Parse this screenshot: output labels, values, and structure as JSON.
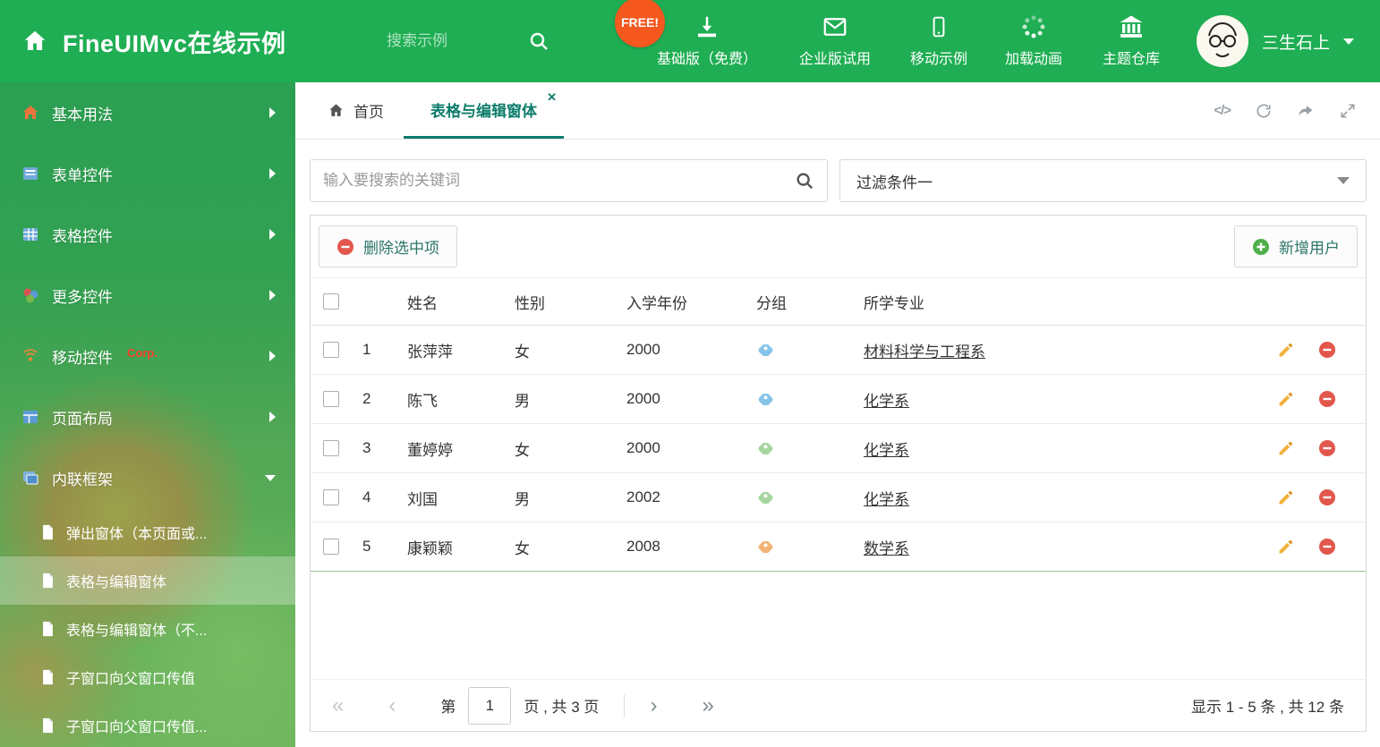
{
  "header": {
    "title": "FineUIMvc在线示例",
    "search_placeholder": "搜索示例",
    "free_badge": "FREE!",
    "nav": [
      {
        "label": "基础版（免费）",
        "icon": "download-icon"
      },
      {
        "label": "企业版试用",
        "icon": "envelope-icon"
      },
      {
        "label": "移动示例",
        "icon": "mobile-icon"
      },
      {
        "label": "加载动画",
        "icon": "spinner-icon"
      },
      {
        "label": "主题仓库",
        "icon": "bank-icon"
      }
    ],
    "user_name": "三生石上"
  },
  "sidebar": {
    "items": [
      {
        "label": "基本用法",
        "icon": "home-icon"
      },
      {
        "label": "表单控件",
        "icon": "form-icon"
      },
      {
        "label": "表格控件",
        "icon": "table-icon"
      },
      {
        "label": "更多控件",
        "icon": "widgets-icon"
      },
      {
        "label": "移动控件",
        "badge": "Corp.",
        "icon": "antenna-icon"
      },
      {
        "label": "页面布局",
        "icon": "layout-icon"
      },
      {
        "label": "内联框架",
        "icon": "frame-icon"
      }
    ],
    "subitems": [
      {
        "label": "弹出窗体（本页面或..."
      },
      {
        "label": "表格与编辑窗体",
        "active": true
      },
      {
        "label": "表格与编辑窗体（不..."
      },
      {
        "label": "子窗口向父窗口传值"
      },
      {
        "label": "子窗口向父窗口传值..."
      }
    ]
  },
  "tabs": {
    "home_label": "首页",
    "active_label": "表格与编辑窗体",
    "close_glyph": "✕"
  },
  "tab_actions": {
    "code_glyph": "</>"
  },
  "filters": {
    "search_placeholder": "输入要搜索的关键词",
    "dropdown_value": "过滤条件一"
  },
  "toolbar": {
    "delete_label": "删除选中项",
    "add_label": "新增用户"
  },
  "table": {
    "columns": [
      "姓名",
      "性别",
      "入学年份",
      "分组",
      "所学专业"
    ],
    "rows": [
      {
        "num": "1",
        "name": "张萍萍",
        "gender": "女",
        "year": "2000",
        "tag_color": "#85c4e8",
        "major": "材料科学与工程系"
      },
      {
        "num": "2",
        "name": "陈飞",
        "gender": "男",
        "year": "2000",
        "tag_color": "#85c4e8",
        "major": "化学系"
      },
      {
        "num": "3",
        "name": "董婷婷",
        "gender": "女",
        "year": "2000",
        "tag_color": "#a5d6a0",
        "major": "化学系"
      },
      {
        "num": "4",
        "name": "刘国",
        "gender": "男",
        "year": "2002",
        "tag_color": "#a5d6a0",
        "major": "化学系"
      },
      {
        "num": "5",
        "name": "康颖颖",
        "gender": "女",
        "year": "2008",
        "tag_color": "#f2b377",
        "major": "数学系"
      }
    ]
  },
  "pagination": {
    "first_glyph": "«",
    "prev_glyph": "‹",
    "page_label_prefix": "第",
    "page_value": "1",
    "page_label_suffix": "页 , 共 3 页",
    "next_glyph": "›",
    "last_glyph": "»",
    "summary": "显示 1 - 5 条 , 共 12 条"
  },
  "colors": {
    "header_green": "#1fae53",
    "accent_teal": "#0c7c6a",
    "free_badge_orange": "#f4581f",
    "delete_red": "#e2574c",
    "add_green": "#4fae4a",
    "pencil_yellow": "#f0b23c"
  }
}
